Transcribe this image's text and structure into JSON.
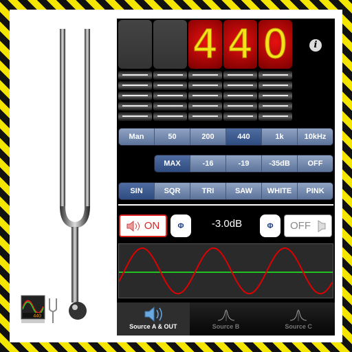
{
  "display": {
    "digits": [
      "",
      "",
      "4",
      "4",
      "0"
    ]
  },
  "frequency_presets": [
    {
      "label": "Man"
    },
    {
      "label": "50"
    },
    {
      "label": "200"
    },
    {
      "label": "440",
      "selected": true
    },
    {
      "label": "1k"
    },
    {
      "label": "10kHz"
    }
  ],
  "level_presets": [
    {
      "label": "MAX",
      "selected": true
    },
    {
      "label": "-16"
    },
    {
      "label": "-19"
    },
    {
      "label": "-35dB"
    },
    {
      "label": "OFF"
    }
  ],
  "waveforms": [
    {
      "label": "SIN",
      "selected": true
    },
    {
      "label": "SQR"
    },
    {
      "label": "TRI"
    },
    {
      "label": "SAW"
    },
    {
      "label": "WHITE"
    },
    {
      "label": "PINK"
    }
  ],
  "controls": {
    "left_output": "ON",
    "right_output": "OFF",
    "phase_symbol": "Φ",
    "level": "-3.0dB"
  },
  "info_icon": "i",
  "tabs": [
    {
      "label": "Source A & OUT",
      "icon": "speaker-icon",
      "selected": true
    },
    {
      "label": "Source B",
      "icon": "bell-curve-icon"
    },
    {
      "label": "Source C",
      "icon": "bell-curve-icon"
    }
  ],
  "app_icon_label": "440",
  "colors": {
    "hazard_yellow": "#f5e600",
    "display_red": "#e81010",
    "digit_yellow": "#f6e21a",
    "segment_blue": "#5c739a",
    "on_red": "#dd2222",
    "wave_red": "#e00000",
    "baseline_green": "#22cc22"
  }
}
